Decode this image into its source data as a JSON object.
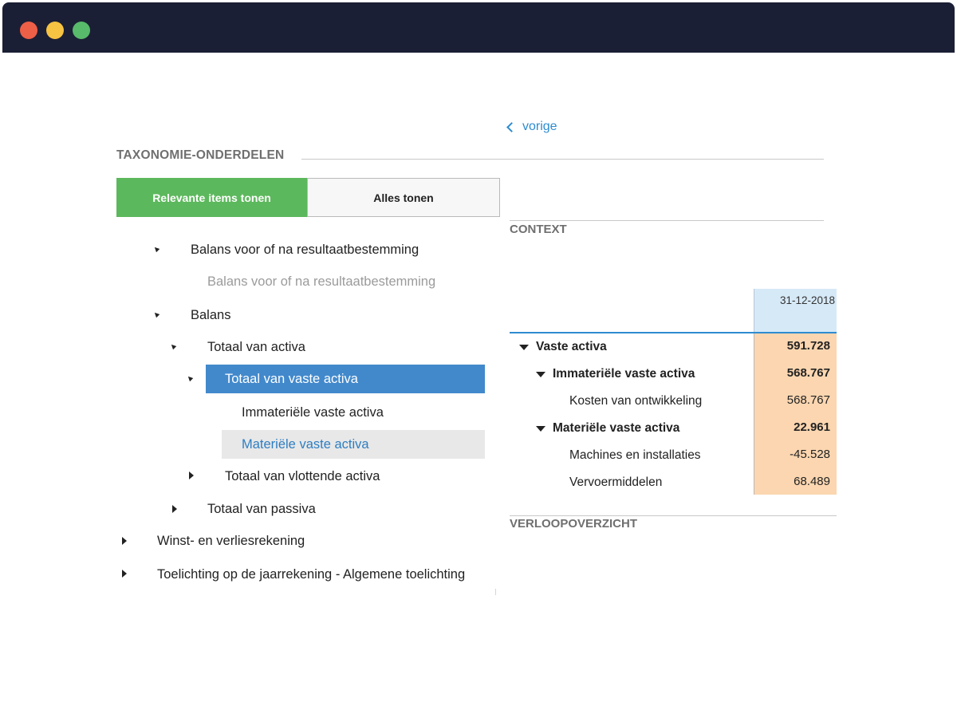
{
  "left_panel": {
    "title": "TAXONOMIE-ONDERDELEN",
    "toggle_relevant": "Relevante items tonen",
    "toggle_all": "Alles tonen",
    "tree": [
      {
        "label": "Balans voor of na resultaatbestemming",
        "state": "expanded"
      },
      {
        "label": "Balans voor of na resultaatbestemming",
        "state": "leaf-muted"
      },
      {
        "label": "Balans",
        "state": "expanded"
      },
      {
        "label": "Totaal van activa",
        "state": "expanded"
      },
      {
        "label": "Totaal van vaste activa",
        "state": "expanded-selected"
      },
      {
        "label": "Immateriële vaste activa",
        "state": "leaf"
      },
      {
        "label": "Materiële vaste activa",
        "state": "leaf-hovered"
      },
      {
        "label": "Totaal van vlottende activa",
        "state": "collapsed"
      },
      {
        "label": "Totaal van passiva",
        "state": "collapsed"
      },
      {
        "label": "Winst- en verliesrekening",
        "state": "collapsed"
      },
      {
        "label": "Toelichting op de jaarrekening - Algemene toelichting",
        "state": "collapsed"
      }
    ]
  },
  "right_panel": {
    "back_label": "vorige",
    "context_title": "CONTEXT",
    "date_header": "31-12-2018",
    "rows": [
      {
        "label": "Vaste activa",
        "value": "591.728",
        "bold": true,
        "toggle": "expanded"
      },
      {
        "label": "Immateriële vaste activa",
        "value": "568.767",
        "bold": true,
        "toggle": "expanded"
      },
      {
        "label": "Kosten van ontwikkeling",
        "value": "568.767",
        "bold": false,
        "toggle": "none"
      },
      {
        "label": "Materiële vaste activa",
        "value": "22.961",
        "bold": true,
        "toggle": "expanded"
      },
      {
        "label": "Machines en installaties",
        "value": "-45.528",
        "bold": false,
        "toggle": "none"
      },
      {
        "label": "Vervoermiddelen",
        "value": "68.489",
        "bold": false,
        "toggle": "none"
      }
    ],
    "verloop_title": "VERLOOPOVERZICHT"
  },
  "colors": {
    "window_bar": "#1b1f35",
    "toggle_active": "#5cb85c",
    "selected_row": "#4289cc",
    "link": "#2e8cd0",
    "value_column": "#fbd6b0",
    "date_header": "#d6e9f7"
  }
}
